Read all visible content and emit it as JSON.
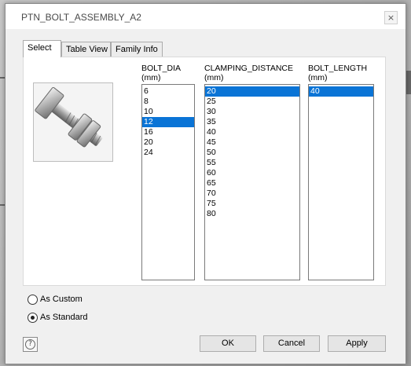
{
  "window": {
    "title": "PTN_BOLT_ASSEMBLY_A2",
    "close_glyph": "×"
  },
  "tabs": [
    {
      "label": "Select",
      "active": true
    },
    {
      "label": "Table View",
      "active": false
    },
    {
      "label": "Family Info",
      "active": false
    }
  ],
  "preview": {
    "icon": "bolt-nut-image"
  },
  "columns": [
    {
      "header": "BOLT_DIA",
      "unit": "(mm)",
      "items": [
        "6",
        "8",
        "10",
        "12",
        "16",
        "20",
        "24"
      ],
      "selected": "12"
    },
    {
      "header": "CLAMPING_DISTANCE",
      "unit": "(mm)",
      "items": [
        "20",
        "25",
        "30",
        "35",
        "40",
        "45",
        "50",
        "55",
        "60",
        "65",
        "70",
        "75",
        "80"
      ],
      "selected": "20"
    },
    {
      "header": "BOLT_LENGTH",
      "unit": "(mm)",
      "items": [
        "40"
      ],
      "selected": "40"
    }
  ],
  "options": {
    "as_custom": {
      "label": "As Custom",
      "checked": false
    },
    "as_standard": {
      "label": "As Standard",
      "checked": true
    }
  },
  "footer": {
    "help_glyph": "?",
    "ok_label": "OK",
    "cancel_label": "Cancel",
    "apply_label": "Apply"
  },
  "colors": {
    "selection": "#0a74d6"
  }
}
